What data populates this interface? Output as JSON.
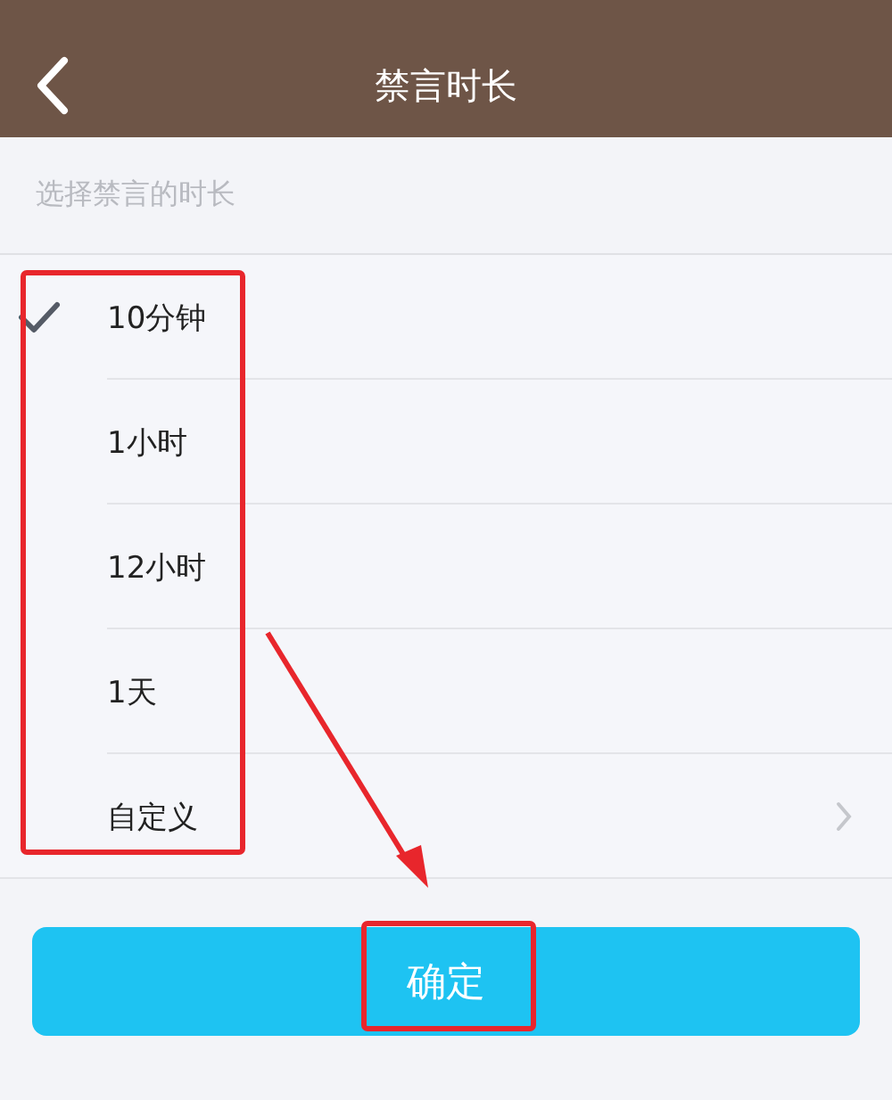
{
  "nav_bar": {
    "title": "禁言时长"
  },
  "section_label": "选择禁言的时长",
  "options": [
    {
      "label": "10分钟",
      "kind": "choice",
      "selected": true
    },
    {
      "label": "1小时",
      "kind": "choice",
      "selected": false
    },
    {
      "label": "12小时",
      "kind": "choice",
      "selected": false
    },
    {
      "label": "1天",
      "kind": "choice",
      "selected": false
    },
    {
      "label": "自定义",
      "kind": "link",
      "selected": false
    }
  ],
  "confirm_button": "确定"
}
